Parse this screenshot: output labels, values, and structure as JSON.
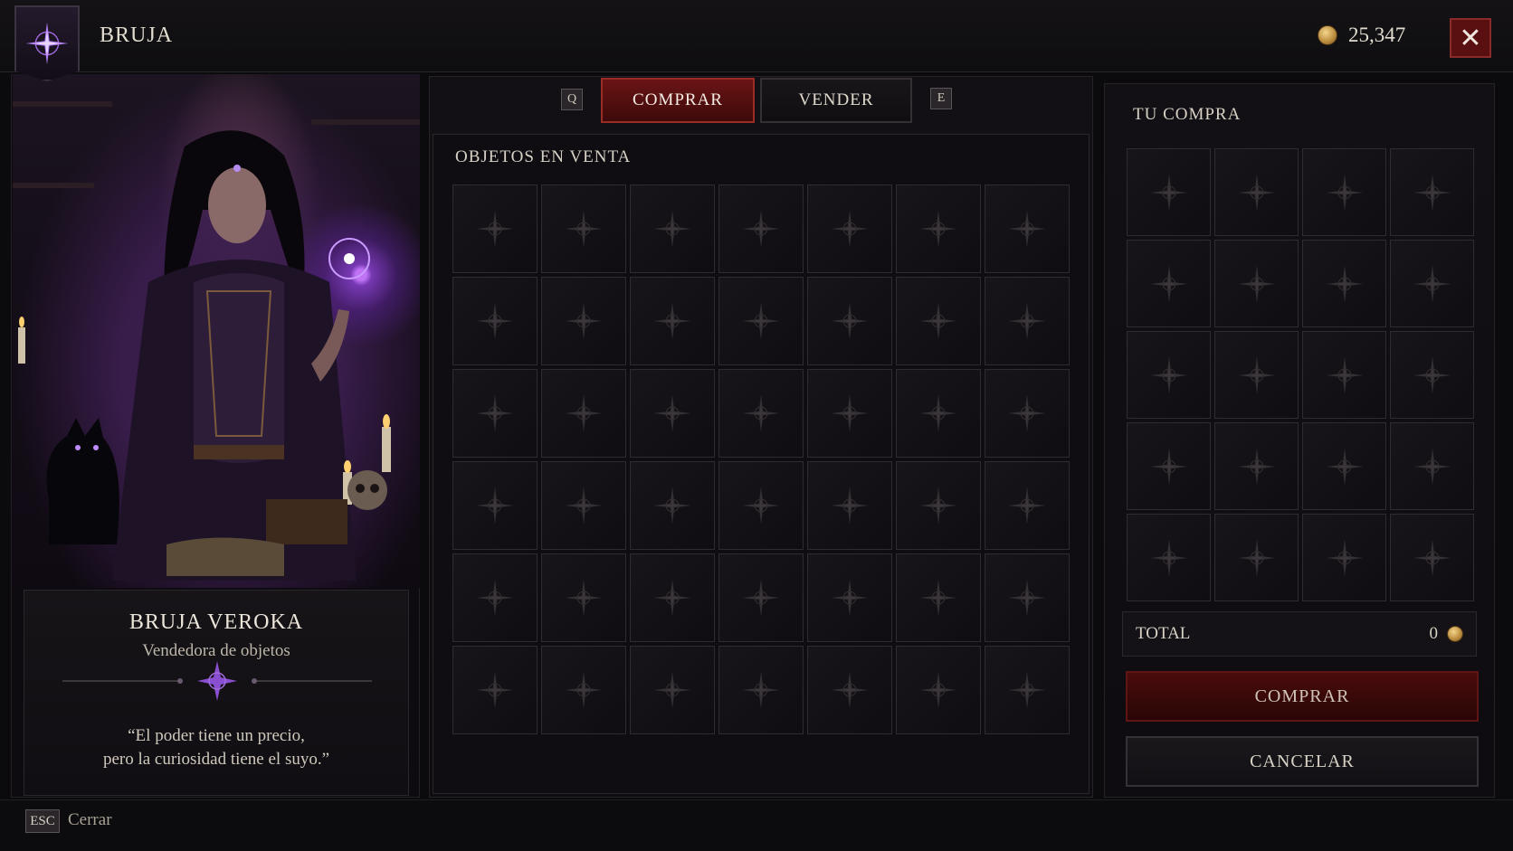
{
  "header": {
    "title": "BRUJA",
    "gold": "25,347",
    "close_label": "✕"
  },
  "npc": {
    "name": "BRUJA VEROKA",
    "role": "Vendedora de objetos",
    "quote_line1": "“El poder tiene un precio,",
    "quote_line2": "pero la curiosidad tiene el suyo.”"
  },
  "tabs": {
    "prev_key": "Q",
    "buy": "COMPRAR",
    "sell": "VENDER",
    "next_key": "E",
    "active": "COMPRAR"
  },
  "shop": {
    "heading": "OBJETOS EN VENTA",
    "columns": 7,
    "rows": 6
  },
  "purchase": {
    "heading": "TU COMPRA",
    "columns": 4,
    "rows": 5,
    "total_label": "TOTAL",
    "total_value": "0",
    "buy_label": "COMPRAR",
    "cancel_label": "CANCELAR"
  },
  "footer": {
    "key": "ESC",
    "label": "Cerrar"
  },
  "icons": {
    "emblem": "sigil-star-icon",
    "gold": "coin-icon",
    "slot": "empty-slot-star-icon"
  },
  "colors": {
    "accent_red": "#6a1414",
    "accent_purple": "#8a3fd6",
    "gold": "#d4a24e"
  }
}
